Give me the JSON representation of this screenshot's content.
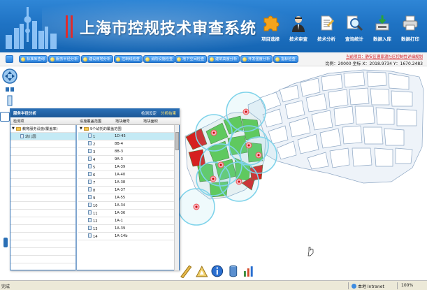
{
  "header": {
    "title": "上海市控规技术审查系统",
    "buttons": [
      {
        "label": "项目选择",
        "icon": "puzzle-icon"
      },
      {
        "label": "技术审查",
        "icon": "officer-icon"
      },
      {
        "label": "技术分析",
        "icon": "document-icon"
      },
      {
        "label": "查询统计",
        "icon": "magnifier-icon"
      },
      {
        "label": "数据入库",
        "icon": "database-icon"
      },
      {
        "label": "数据打印",
        "icon": "printer-icon"
      }
    ]
  },
  "toolbar": {
    "buttons": [
      "标准库查询",
      "服务半径分析",
      "建设用地分析",
      "控制线检查",
      "消防设施检查",
      "地下空间检查",
      "建筑高度分析",
      "开发强度分析",
      "指标检查"
    ]
  },
  "status_area": {
    "project": "当前项目：静安区曹家渡社区控制性详细规划",
    "scale": "比例：20000 坐标 X：2018.9734 Y：1670.2483"
  },
  "panel": {
    "title": "服务半径分析",
    "links": {
      "settings": "检测设定",
      "results": "分析结果"
    },
    "tabs": {
      "left": "检测项",
      "mid": "设施覆盖范围",
      "c1": "地块编号",
      "c2": "地块面积"
    },
    "tree": {
      "root": "教育服务设施(覆盖率)",
      "child": "幼儿园"
    },
    "list_root": "9个幼托的覆盖范围",
    "rows": [
      {
        "n": "1",
        "code": "1D-45"
      },
      {
        "n": "2",
        "code": "8B-4"
      },
      {
        "n": "3",
        "code": "8B-3"
      },
      {
        "n": "4",
        "code": "9A-3"
      },
      {
        "n": "5",
        "code": "1A-39"
      },
      {
        "n": "6",
        "code": "1A-40"
      },
      {
        "n": "7",
        "code": "1A-38"
      },
      {
        "n": "8",
        "code": "1A-37"
      },
      {
        "n": "9",
        "code": "1A-55"
      },
      {
        "n": "10",
        "code": "1A-34"
      },
      {
        "n": "11",
        "code": "1A-36"
      },
      {
        "n": "12",
        "code": "1A-1"
      },
      {
        "n": "13",
        "code": "1A-39"
      },
      {
        "n": "14",
        "code": "1A-14b"
      }
    ]
  },
  "statusbar": {
    "done": "完成",
    "zone": "本地 Intranet",
    "zoom": "100%"
  },
  "colors": {
    "header_blue": "#1f73c4",
    "title_red": "#e02b2b",
    "coverage_green": "#5cc84d",
    "outside_red": "#d62020",
    "circle_cyan": "#7fd3ea"
  }
}
